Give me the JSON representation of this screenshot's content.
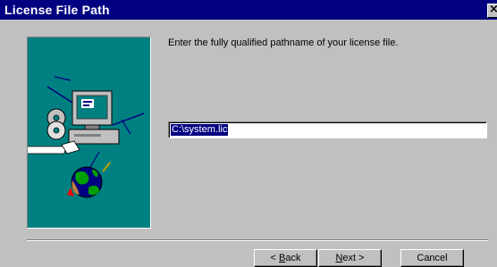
{
  "window": {
    "title": "License File Path",
    "close_glyph": "×"
  },
  "prompt": "Enter the fully qualified pathname of your license file.",
  "path_field": {
    "value": "C:\\system.lic"
  },
  "buttons": {
    "back": {
      "prefix": "< ",
      "mnemonic": "B",
      "rest": "ack"
    },
    "next": {
      "mnemonic": "N",
      "rest": "ext >"
    },
    "cancel": "Cancel"
  },
  "illustration": {
    "icons": [
      "computer-icon",
      "cd-icon",
      "globe-icon",
      "cable-icon"
    ],
    "panel_color": "#008080"
  },
  "colors": {
    "titlebar": "#000080",
    "selection": "#000080",
    "face": "#c0c0c0"
  }
}
